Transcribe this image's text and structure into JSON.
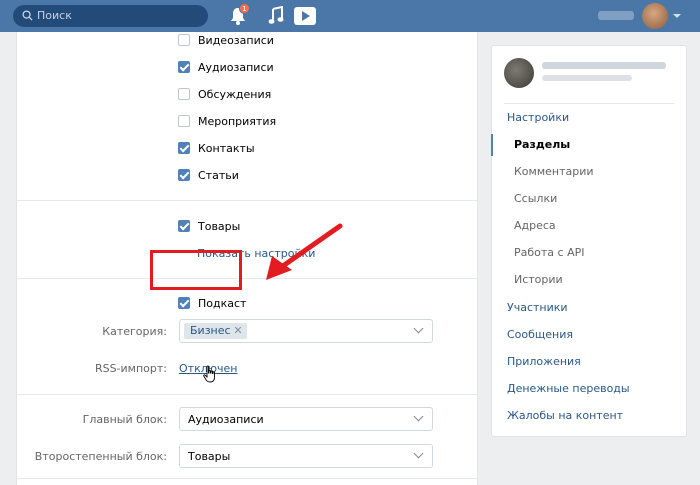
{
  "header": {
    "search_placeholder": "Поиск",
    "notification_count": "1"
  },
  "sections": {
    "checkboxes_top": [
      {
        "label": "Видеозаписи",
        "checked": false
      },
      {
        "label": "Аудиозаписи",
        "checked": true
      },
      {
        "label": "Обсуждения",
        "checked": false
      },
      {
        "label": "Мероприятия",
        "checked": false
      },
      {
        "label": "Контакты",
        "checked": true
      },
      {
        "label": "Статьи",
        "checked": true
      }
    ],
    "goods": {
      "label": "Товары",
      "checked": true
    },
    "show_settings_link": "Показать настройки",
    "podcast": {
      "label": "Подкаст",
      "checked": true
    },
    "category_label": "Категория:",
    "category_token": "Бизнес",
    "rss_label": "RSS-импорт:",
    "rss_value": "Отключен",
    "main_block_label": "Главный блок:",
    "main_block_value": "Аудиозаписи",
    "secondary_block_label": "Второстепенный блок:",
    "secondary_block_value": "Товары"
  },
  "sidebar": {
    "items": [
      {
        "label": "Настройки",
        "level": "main",
        "active": false
      },
      {
        "label": "Разделы",
        "level": "sub",
        "active": true
      },
      {
        "label": "Комментарии",
        "level": "sub",
        "active": false
      },
      {
        "label": "Ссылки",
        "level": "sub",
        "active": false
      },
      {
        "label": "Адреса",
        "level": "sub",
        "active": false
      },
      {
        "label": "Работа с API",
        "level": "sub",
        "active": false
      },
      {
        "label": "Истории",
        "level": "sub",
        "active": false
      },
      {
        "label": "Участники",
        "level": "main",
        "active": false
      },
      {
        "label": "Сообщения",
        "level": "main",
        "active": false
      },
      {
        "label": "Приложения",
        "level": "main",
        "active": false
      },
      {
        "label": "Денежные переводы",
        "level": "main",
        "active": false
      },
      {
        "label": "Жалобы на контент",
        "level": "main",
        "active": false
      }
    ]
  },
  "colors": {
    "header_bg": "#4a76a8",
    "accent": "#5181b8",
    "link": "#2a5885",
    "annotation_red": "#e21c20"
  },
  "icons": [
    "search-icon",
    "bell-icon",
    "music-icon",
    "video-icon",
    "chevron-down-icon",
    "remove-tag-icon",
    "cursor-hand-icon",
    "annotation-arrow-icon"
  ]
}
